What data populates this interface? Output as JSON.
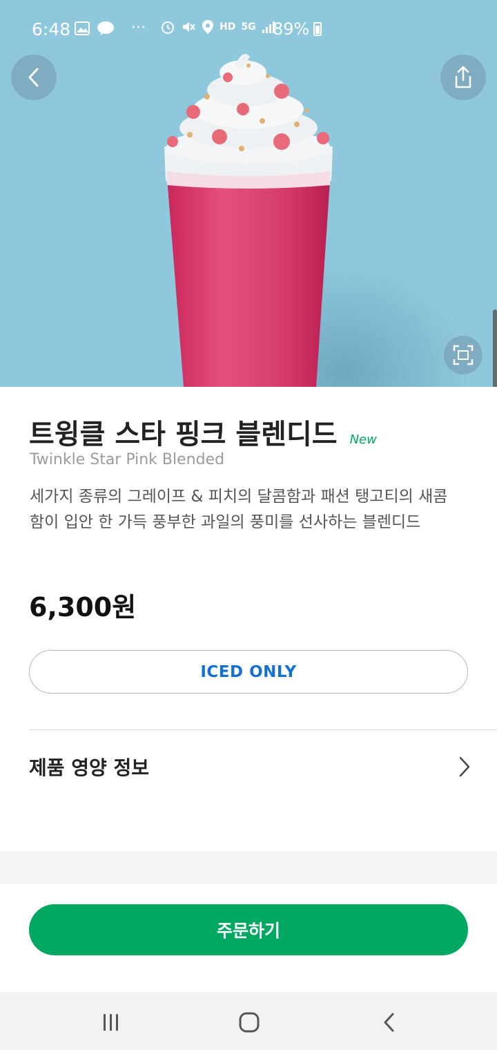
{
  "status_bar": {
    "time": "6:48",
    "dots": "···",
    "battery": "89%",
    "network_hd": "HD",
    "network_5g": "5G"
  },
  "hero": {
    "background_color": "#8fc7dc",
    "icons": [
      "chevron-left-icon",
      "share-icon",
      "fullscreen-icon"
    ]
  },
  "product": {
    "name_ko": "트윙클 스타 핑크 블렌디드",
    "badge": "New",
    "name_en": "Twinkle Star Pink Blended",
    "description": "세가지 종류의 그레이프 & 피치의 달콤함과 패션 탱고티의 새콤함이 입안 한 가득 풍부한 과일의 풍미를 선사하는 블렌디드",
    "price": "6,300원",
    "temperature_option": "ICED ONLY"
  },
  "nutrition": {
    "label": "제품 영양 정보"
  },
  "order": {
    "label": "주문하기"
  },
  "colors": {
    "accent_green": "#00a862",
    "option_blue": "#1570d6"
  },
  "nav": {
    "icons": [
      "recent-apps-icon",
      "home-icon",
      "back-icon"
    ]
  }
}
